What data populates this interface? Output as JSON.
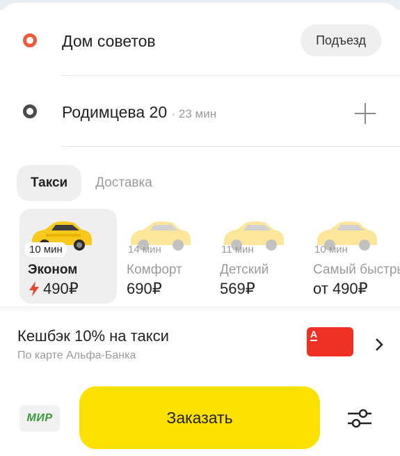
{
  "route": {
    "from": {
      "address": "Дом советов",
      "entrance_label": "Подъезд"
    },
    "to": {
      "address": "Родимцева 20",
      "eta": "· 23 мин"
    }
  },
  "tabs": [
    {
      "label": "Такси",
      "active": true
    },
    {
      "label": "Доставка",
      "active": false
    }
  ],
  "tariffs": [
    {
      "eta": "10 мин",
      "name": "Эконом",
      "price": "490₽",
      "selected": true,
      "surge_icon": "lightning-bolt-icon"
    },
    {
      "eta": "14 мин",
      "name": "Комфорт",
      "price": "690₽",
      "selected": false
    },
    {
      "eta": "11 мин",
      "name": "Детский",
      "price": "569₽",
      "selected": false
    },
    {
      "eta": "10 мин",
      "name": "Самый быстрый",
      "price": "от 490₽",
      "selected": false
    }
  ],
  "cashback": {
    "title": "Кешбэк 10% на такси",
    "subtitle": "По карте Альфа-Банка",
    "bank_logo_letter": "А"
  },
  "payment": {
    "label": "МИР"
  },
  "order_button": {
    "label": "Заказать"
  },
  "colors": {
    "accent": "#fce000",
    "origin_dot": "#ee5a3a",
    "bank_card": "#ef3124",
    "surge": "#e8452d"
  }
}
